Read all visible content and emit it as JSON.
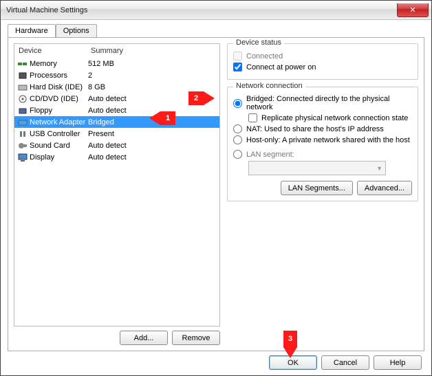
{
  "window": {
    "title": "Virtual Machine Settings",
    "close_glyph": "✕"
  },
  "tabs": {
    "hardware": "Hardware",
    "options": "Options"
  },
  "columns": {
    "device": "Device",
    "summary": "Summary"
  },
  "devices": [
    {
      "name": "Memory",
      "summary": "512 MB"
    },
    {
      "name": "Processors",
      "summary": "2"
    },
    {
      "name": "Hard Disk (IDE)",
      "summary": "8 GB"
    },
    {
      "name": "CD/DVD (IDE)",
      "summary": "Auto detect"
    },
    {
      "name": "Floppy",
      "summary": "Auto detect"
    },
    {
      "name": "Network Adapter",
      "summary": "Bridged"
    },
    {
      "name": "USB Controller",
      "summary": "Present"
    },
    {
      "name": "Sound Card",
      "summary": "Auto detect"
    },
    {
      "name": "Display",
      "summary": "Auto detect"
    }
  ],
  "device_selected_index": 5,
  "list_buttons": {
    "add": "Add...",
    "remove": "Remove"
  },
  "status": {
    "title": "Device status",
    "connected": "Connected",
    "connected_checked": false,
    "connect_power": "Connect at power on",
    "connect_power_checked": true
  },
  "netconn": {
    "title": "Network connection",
    "bridged": "Bridged: Connected directly to the physical network",
    "replicate": "Replicate physical network connection state",
    "replicate_checked": false,
    "nat": "NAT: Used to share the host's IP address",
    "hostonly": "Host-only: A private network shared with the host",
    "lanseg": "LAN segment:",
    "selected": "bridged",
    "lan_segments_btn": "LAN Segments...",
    "advanced_btn": "Advanced..."
  },
  "bottom": {
    "ok": "OK",
    "cancel": "Cancel",
    "help": "Help"
  },
  "callouts": {
    "c1": "1",
    "c2": "2",
    "c3": "3"
  }
}
